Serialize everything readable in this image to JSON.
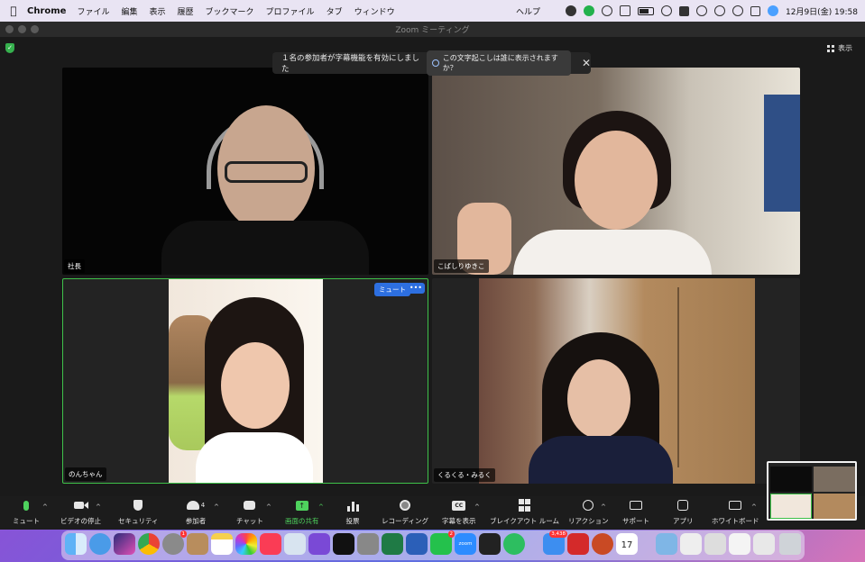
{
  "menubar": {
    "app_name": "Chrome",
    "menus": [
      "ファイル",
      "編集",
      "表示",
      "履歴",
      "ブックマーク",
      "プロファイル",
      "タブ",
      "ウィンドウ"
    ],
    "help": "ヘルプ",
    "datetime": "12月9日(金)  19:58"
  },
  "window": {
    "title": "Zoom ミーティング",
    "view_label": "表示"
  },
  "caption_banner": {
    "message": "１名の参加者が字幕機能を有効にしました",
    "question_button": "この文字起こしは誰に表示されますか？",
    "close": "✕"
  },
  "tiles": [
    {
      "name": "社長"
    },
    {
      "name": "こばしりゆきこ"
    },
    {
      "name": "のんちゃん",
      "mute_button": "ミュート",
      "more_button": "•••"
    },
    {
      "name": "くるくる・みるく"
    }
  ],
  "toolbar": {
    "items": [
      {
        "label": "ミュート",
        "icon": "microphone-icon"
      },
      {
        "label": "ビデオの停止",
        "icon": "video-camera-icon"
      },
      {
        "label": "セキュリティ",
        "icon": "shield-icon"
      },
      {
        "label": "参加者",
        "icon": "participants-icon",
        "count": "4"
      },
      {
        "label": "チャット",
        "icon": "chat-icon"
      },
      {
        "label": "画面の共有",
        "icon": "share-screen-icon"
      },
      {
        "label": "投票",
        "icon": "poll-icon"
      },
      {
        "label": "レコーディング",
        "icon": "record-icon"
      },
      {
        "label": "字幕を表示",
        "icon": "cc-icon",
        "icon_text": "CC"
      },
      {
        "label": "ブレイクアウト ルーム",
        "icon": "breakout-rooms-icon"
      },
      {
        "label": "リアクション",
        "icon": "reaction-icon"
      },
      {
        "label": "サポート",
        "icon": "support-icon"
      },
      {
        "label": "アプリ",
        "icon": "apps-icon"
      },
      {
        "label": "ホワイトボード",
        "icon": "whiteboard-icon"
      }
    ]
  },
  "dock": {
    "badges": {
      "settings": "1",
      "mail": "3,438",
      "line": "2"
    },
    "calendar_day": "17",
    "zoom_label": "zoom"
  },
  "colors": {
    "active_border": "#3fc24a",
    "share_green": "#4ed25d",
    "accent_blue": "#2d6fe0",
    "toolbar_bg": "#1c1c1c"
  }
}
